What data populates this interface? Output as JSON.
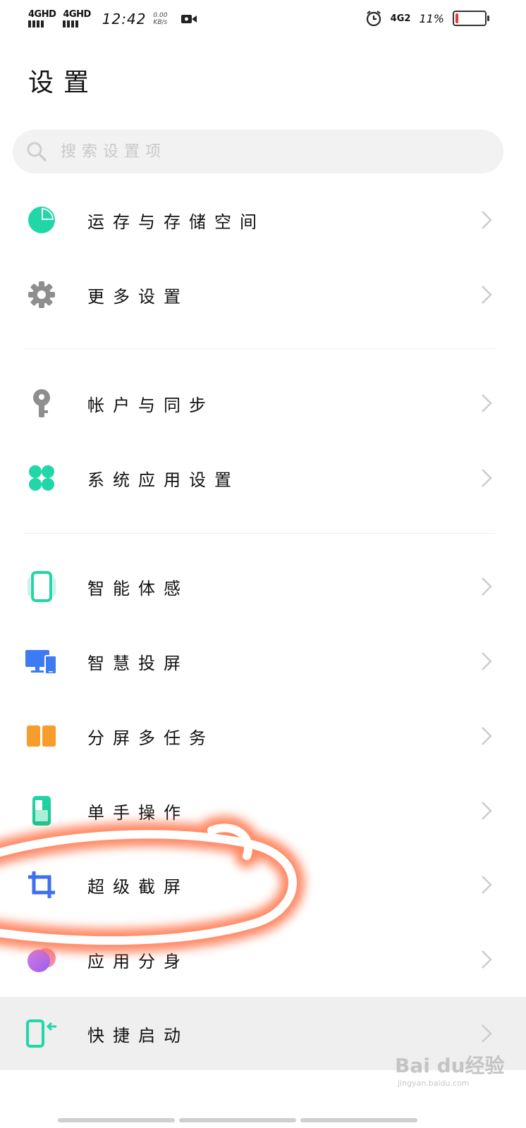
{
  "status_bar": {
    "sim1_label": "4GHD",
    "sim2_label": "4GHD",
    "time": "12:42",
    "speed_value": "0.00",
    "speed_unit": "KB/s",
    "network2": "4G2",
    "battery_percent_text": "11%",
    "battery_level": 0.11,
    "battery_color": "#e53935"
  },
  "page": {
    "title": "设置"
  },
  "search": {
    "placeholder": "搜索设置项"
  },
  "settings": {
    "memory_storage": {
      "label": "运存与存储空间",
      "icon": "pie-chart-icon",
      "color": "#21d6a7"
    },
    "more_settings": {
      "label": "更多设置",
      "icon": "gear-icon",
      "color": "#8e8e8e"
    },
    "accounts_sync": {
      "label": "帐户与同步",
      "icon": "key-icon",
      "color": "#8e8e8e"
    },
    "system_app_settings": {
      "label": "系统应用设置",
      "icon": "clover-icon",
      "color": "#21d6a7"
    },
    "smart_motion": {
      "label": "智能体感",
      "icon": "phone-motion-icon",
      "color": "#21d6a7"
    },
    "smart_cast": {
      "label": "智慧投屏",
      "icon": "screen-cast-icon",
      "color": "#3d7bf0"
    },
    "split_screen": {
      "label": "分屏多任务",
      "icon": "split-screen-icon",
      "color": "#f79d2c"
    },
    "one_hand": {
      "label": "单手操作",
      "icon": "one-hand-icon",
      "color": "#21d6a7"
    },
    "super_screenshot": {
      "label": "超级截屏",
      "icon": "crop-icon",
      "color": "#3d6ff0"
    },
    "app_clone": {
      "label": "应用分身",
      "icon": "app-clone-icon",
      "color": "#b96be5"
    },
    "quick_launch": {
      "label": "快捷启动",
      "icon": "quick-launch-icon",
      "color": "#21d6a7"
    }
  },
  "annotation": {
    "stroke_color": "#ff6a3d"
  },
  "watermark": {
    "brand": "Bai du经验",
    "url": "jingyan.baidu.com"
  }
}
